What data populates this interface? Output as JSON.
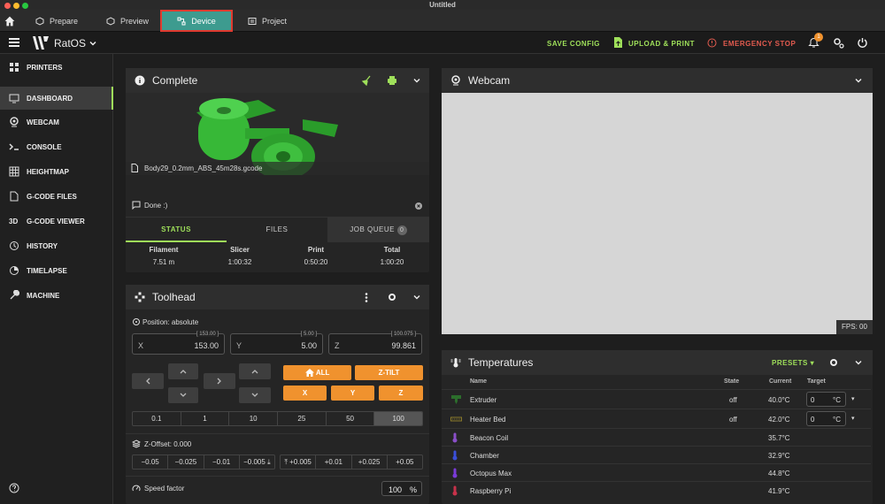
{
  "window": {
    "title": "Untitled"
  },
  "tabs": [
    {
      "label": "Prepare"
    },
    {
      "label": "Preview"
    },
    {
      "label": "Device"
    },
    {
      "label": "Project"
    }
  ],
  "app": {
    "name": "RatOS",
    "save_config": "SAVE CONFIG",
    "upload_print": "UPLOAD & PRINT",
    "emergency_stop": "EMERGENCY STOP",
    "notification_count": "1"
  },
  "sidebar": {
    "items": [
      {
        "label": "PRINTERS"
      },
      {
        "label": "DASHBOARD"
      },
      {
        "label": "WEBCAM"
      },
      {
        "label": "CONSOLE"
      },
      {
        "label": "HEIGHTMAP"
      },
      {
        "label": "G-CODE FILES"
      },
      {
        "label": "G-CODE VIEWER"
      },
      {
        "label": "HISTORY"
      },
      {
        "label": "TIMELAPSE"
      },
      {
        "label": "MACHINE"
      }
    ],
    "viewer_prefix": "3D"
  },
  "status_card": {
    "title": "Complete",
    "filename": "Body29_0.2mm_ABS_45m28s.gcode",
    "message": "Done :)",
    "tabs": [
      {
        "label": "STATUS"
      },
      {
        "label": "FILES"
      },
      {
        "label": "JOB QUEUE"
      }
    ],
    "job_queue_count": "0",
    "stats": [
      {
        "label": "Filament",
        "value": "7.51 m"
      },
      {
        "label": "Slicer",
        "value": "1:00:32"
      },
      {
        "label": "Print",
        "value": "0:50:20"
      },
      {
        "label": "Total",
        "value": "1:00:20"
      }
    ]
  },
  "toolhead": {
    "title": "Toolhead",
    "position_label": "Position: absolute",
    "axes": [
      {
        "name": "X",
        "max": "[ 153.00 ]",
        "value": "153.00"
      },
      {
        "name": "Y",
        "max": "[ 5.00 ]",
        "value": "5.00"
      },
      {
        "name": "Z",
        "max": "[ 100.075 ]",
        "value": "99.861"
      }
    ],
    "home_all": "ALL",
    "ztilt": "Z-TILT",
    "home_x": "X",
    "home_y": "Y",
    "home_z": "Z",
    "steps": [
      "0.1",
      "1",
      "10",
      "25",
      "50",
      "100"
    ],
    "selected_step": "100",
    "zoffset_label": "Z-Offset: 0.000",
    "zoffset_down": [
      "−0.05",
      "−0.025",
      "−0.01",
      "−0.005"
    ],
    "zoffset_up": [
      "+0.005",
      "+0.01",
      "+0.025",
      "+0.05"
    ],
    "speed_label": "Speed factor",
    "speed_value": "100",
    "speed_unit": "%"
  },
  "webcam": {
    "title": "Webcam",
    "fps": "FPS: 00"
  },
  "temperatures": {
    "title": "Temperatures",
    "presets": "PRESETS",
    "headers": {
      "name": "Name",
      "state": "State",
      "current": "Current",
      "target": "Target"
    },
    "rows": [
      {
        "name": "Extruder",
        "state": "off",
        "current": "40.0°C",
        "target": "0",
        "unit": "°C"
      },
      {
        "name": "Heater Bed",
        "state": "off",
        "current": "42.0°C",
        "target": "0",
        "unit": "°C"
      },
      {
        "name": "Beacon Coil",
        "current": "35.7°C"
      },
      {
        "name": "Chamber",
        "current": "32.9°C"
      },
      {
        "name": "Octopus Max",
        "current": "44.8°C"
      },
      {
        "name": "Raspberry Pi",
        "current": "41.9°C"
      }
    ]
  },
  "colors": {
    "accent": "#9fe05a",
    "orange": "#f0922e",
    "danger": "#e35b4f",
    "device_tab": "#3d9b8f"
  }
}
